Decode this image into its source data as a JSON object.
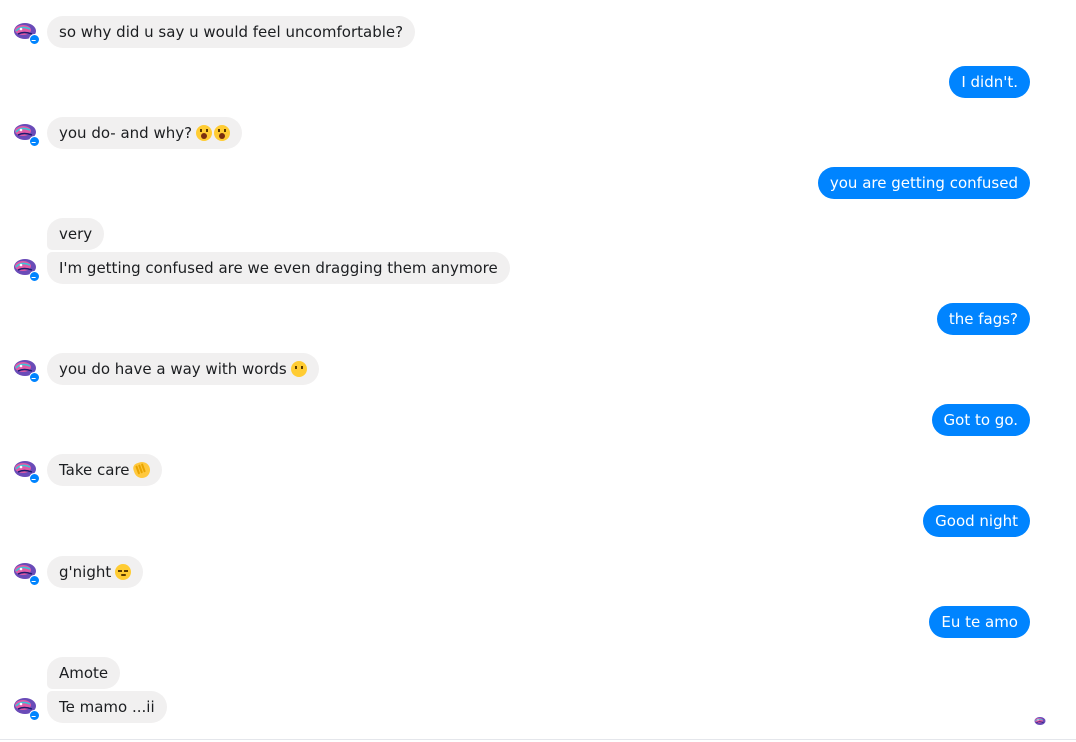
{
  "conversation": {
    "messages": [
      {
        "from": "them",
        "text": "so why did u say u would feel uncomfortable?"
      },
      {
        "from": "me",
        "text": "I didn't."
      },
      {
        "from": "them",
        "text": "you do- and why?",
        "emoji": [
          "astonished-face",
          "astonished-face"
        ]
      },
      {
        "from": "me",
        "text": "you are getting confused"
      },
      {
        "from": "them",
        "text": "very"
      },
      {
        "from": "them",
        "text": "I'm getting confused are we even dragging them anymore"
      },
      {
        "from": "me",
        "text": "the fags?"
      },
      {
        "from": "them",
        "text": "you do have a way with words",
        "emoji": [
          "face-without-mouth"
        ]
      },
      {
        "from": "me",
        "text": "Got to go."
      },
      {
        "from": "them",
        "text": "Take care",
        "emoji": [
          "waving-hand"
        ]
      },
      {
        "from": "me",
        "text": "Good night"
      },
      {
        "from": "them",
        "text": "g'night",
        "emoji": [
          "sleepy-face"
        ]
      },
      {
        "from": "me",
        "text": "Eu te amo"
      },
      {
        "from": "them",
        "text": "Amote"
      },
      {
        "from": "them",
        "text": "Te mamo ...ii"
      }
    ]
  },
  "colors": {
    "outgoing_bubble": "#0084ff",
    "incoming_bubble": "#f1f0f0",
    "messenger_badge": "#0084ff"
  },
  "icons": {
    "avatar": "contact-avatar-icon",
    "badge": "messenger-badge-icon",
    "seen": "seen-avatar-icon"
  }
}
